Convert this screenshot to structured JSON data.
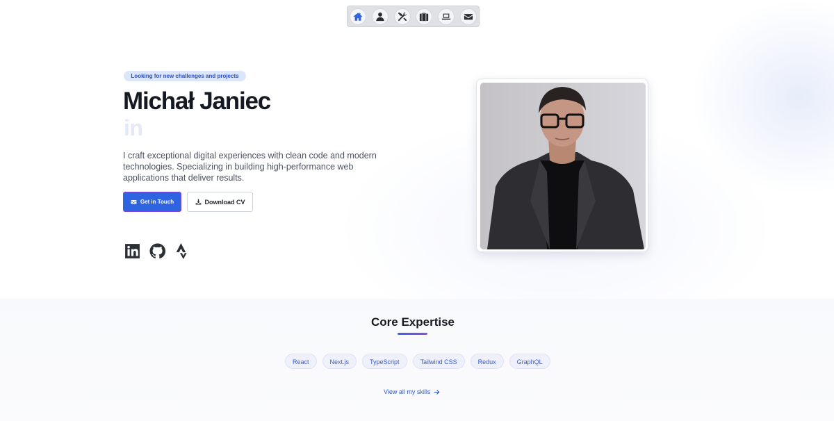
{
  "nav": {
    "items": [
      {
        "icon": "home-icon",
        "active": true
      },
      {
        "icon": "user-icon",
        "active": false
      },
      {
        "icon": "tools-icon",
        "active": false
      },
      {
        "icon": "briefcase-icon",
        "active": false
      },
      {
        "icon": "laptop-icon",
        "active": false
      },
      {
        "icon": "envelope-icon",
        "active": false
      }
    ]
  },
  "hero": {
    "badge": "Looking for new challenges and projects",
    "name": "Michał Janiec",
    "typed_text": "in",
    "intro": "I craft exceptional digital experiences with clean code and modern technologies. Specializing in building high-performance web applications that deliver results.",
    "primary_button": "Get in Touch",
    "secondary_button": "Download CV",
    "socials": [
      "linkedin-icon",
      "github-icon",
      "strava-icon"
    ]
  },
  "expertise": {
    "title": "Core Expertise",
    "skills": [
      "React",
      "Next.js",
      "TypeScript",
      "Tailwind CSS",
      "Redux",
      "GraphQL"
    ],
    "view_all": "View all my skills"
  },
  "colors": {
    "accent": "#2f64e0",
    "accent_purple": "#8a4fdf",
    "badge_bg": "#dce6fb",
    "chip_bg": "#eef1fb",
    "text_dark": "#151922"
  }
}
